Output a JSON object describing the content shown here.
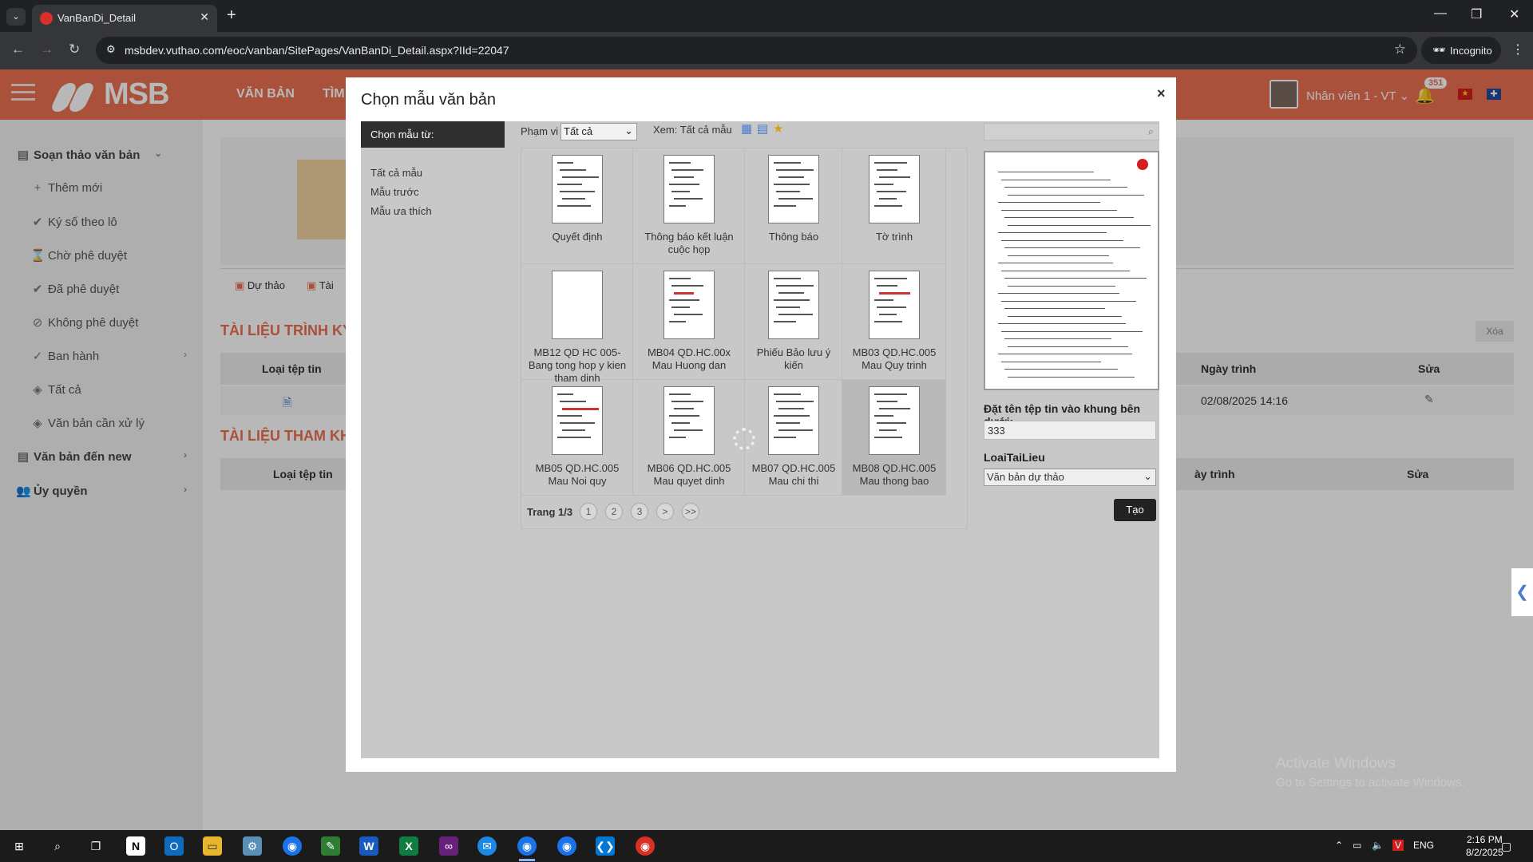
{
  "browser": {
    "tab_title": "VanBanDi_Detail",
    "url": "msbdev.vuthao.com/eoc/vanban/SitePages/VanBanDi_Detail.aspx?IId=22047",
    "incognito_label": "Incognito"
  },
  "header": {
    "logo": "MSB",
    "menu": [
      "VĂN BẢN",
      "TÌM"
    ],
    "username": "Nhân viên 1 - VT",
    "notification_count": "351"
  },
  "sidebar": {
    "items": [
      {
        "label": "Soạn thảo văn bản",
        "icon": "document-icon"
      },
      {
        "label": "Thêm mới",
        "icon": "plus-icon"
      },
      {
        "label": "Ký số theo lô",
        "icon": "check-circle-icon"
      },
      {
        "label": "Chờ phê duyệt",
        "icon": "hourglass-icon"
      },
      {
        "label": "Đã phê duyệt",
        "icon": "check-circle-icon"
      },
      {
        "label": "Không phê duyệt",
        "icon": "ban-icon"
      },
      {
        "label": "Ban hành",
        "icon": "check-outline-icon"
      },
      {
        "label": "Tất cả",
        "icon": "layers-icon"
      },
      {
        "label": "Văn bản cần xử lý",
        "icon": "layers-icon"
      },
      {
        "label": "Văn bản đến new",
        "icon": "document-icon"
      },
      {
        "label": "Ủy quyền",
        "icon": "users-icon"
      }
    ]
  },
  "content": {
    "tabs": [
      "Dự thảo",
      "Tài"
    ],
    "section1_title": "TÀI LIỆU TRÌNH KÝ",
    "section2_title": "TÀI LIỆU THAM KHẢ",
    "col_file_type": "Loại tệp tin",
    "col_date": "Ngày trình",
    "col_edit": "Sửa",
    "col_date2": "ày trình",
    "row_date": "02/08/2025 14:16",
    "delete_label": "Xóa"
  },
  "modal": {
    "title": "Chọn mẫu văn bản",
    "left_header": "Chọn mẫu từ:",
    "left_links": [
      "Tất cả mẫu",
      "Mẫu trước",
      "Mẫu ưa thích"
    ],
    "scope_label": "Phạm vi",
    "scope_value": "Tất cả",
    "view_label": "Xem: Tất cả mẫu",
    "templates": [
      "Quyết định",
      "Thông báo kết luận cuộc họp",
      "Thông báo",
      "Tờ trình",
      "MB12 QD HC 005- Bang tong hop y kien tham dinh",
      "MB04 QD.HC.00x Mau Huong dan",
      "Phiếu Bảo lưu ý kiến",
      "MB03 QD.HC.005 Mau Quy trinh",
      "MB05 QD.HC.005 Mau Noi quy",
      "MB06 QD.HC.005 Mau quyet dinh",
      "MB07 QD.HC.005 Mau chi thi",
      "MB08 QD.HC.005 Mau thong bao"
    ],
    "page_label": "Trang 1/3",
    "pages": [
      "1",
      "2",
      "3",
      ">",
      ">>"
    ],
    "filename_label": "Đặt tên tệp tin vào khung bên dưới:",
    "filename_value": "333",
    "doctype_label": "LoaiTaiLieu",
    "doctype_value": "Văn bản dự thảo",
    "create_label": "Tạo"
  },
  "watermark": {
    "line1": "Activate Windows",
    "line2": "Go to Settings to activate Windows."
  },
  "taskbar": {
    "lang": "ENG",
    "time": "2:16 PM",
    "date": "8/2/2025"
  }
}
